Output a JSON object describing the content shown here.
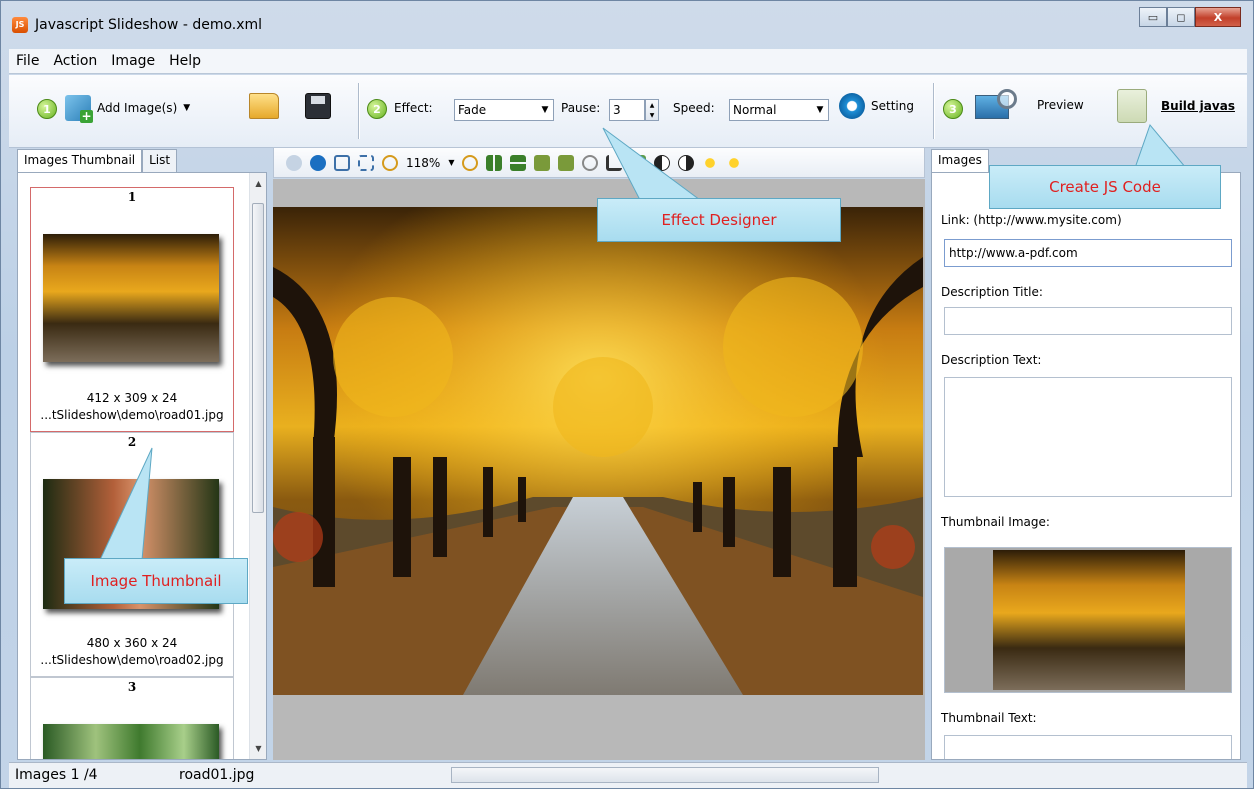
{
  "window": {
    "title": "Javascript Slideshow - demo.xml",
    "app_icon_text": "JS",
    "minimize_glyph": "▭",
    "maximize_glyph": "◻",
    "close_glyph": "X"
  },
  "menu": [
    "File",
    "Action",
    "Image",
    "Help"
  ],
  "toolbar": {
    "step1": "1",
    "add_images": "Add Image(s)",
    "step2": "2",
    "effect_label": "Effect:",
    "effect_value": "Fade",
    "pause_label": "Pause:",
    "pause_value": "3",
    "speed_label": "Speed:",
    "speed_value": "Normal",
    "setting": "Setting",
    "step3": "3",
    "preview": "Preview",
    "build": "Build javas"
  },
  "left": {
    "tabs": [
      "Images Thumbnail",
      "List"
    ],
    "thumbnails": [
      {
        "index": "1",
        "size": "412 x 309 x 24",
        "path": "...tSlideshow\\demo\\road01.jpg"
      },
      {
        "index": "2",
        "size": "480 x 360 x 24",
        "path": "...tSlideshow\\demo\\road02.jpg"
      },
      {
        "index": "3",
        "size": "",
        "path": ""
      }
    ]
  },
  "image_toolbar": {
    "zoom": "118%"
  },
  "right": {
    "tab": "Images",
    "link_label": "Link: (http://www.mysite.com)",
    "link_value": "http://www.a-pdf.com",
    "desc_title_label": "Description Title:",
    "desc_text_label": "Description Text:",
    "thumb_image_label": "Thumbnail Image:",
    "thumb_text_label": "Thumbnail Text:"
  },
  "status": {
    "images": "Images 1 /4",
    "file": "road01.jpg"
  },
  "callouts": {
    "effect_designer": "Effect Designer",
    "create_js": "Create JS Code",
    "image_thumbnail": "Image Thumbnail"
  },
  "colors": {
    "callout_text": "#e02020",
    "callout_bg": "#b9e4f4",
    "autumn_orange": "#d98a12"
  }
}
